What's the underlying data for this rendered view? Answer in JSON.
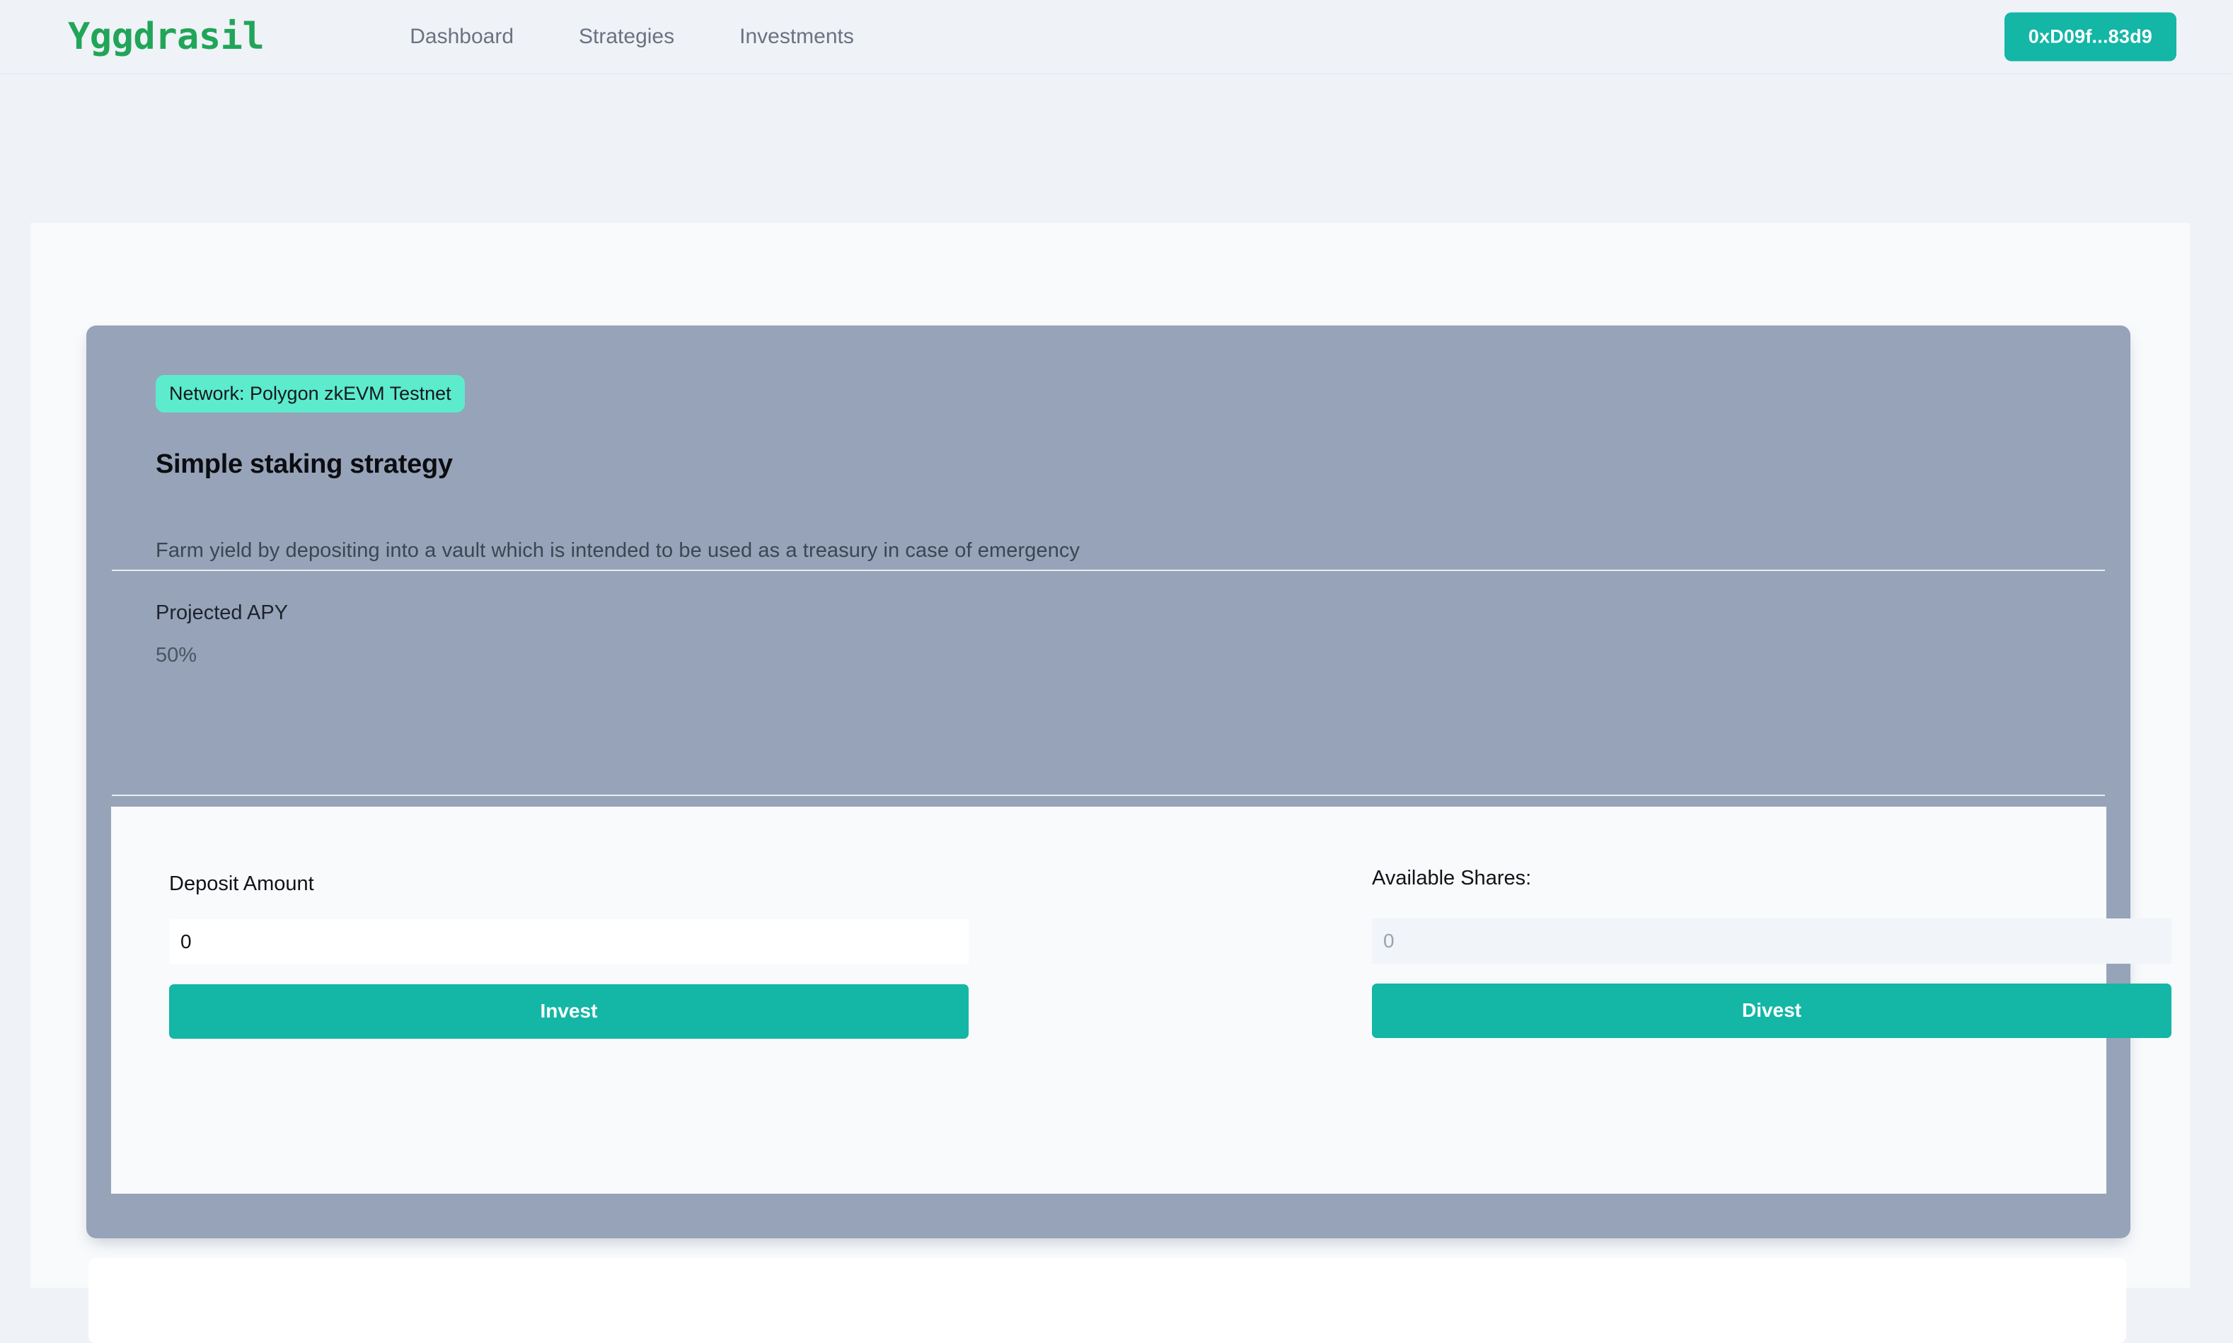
{
  "header": {
    "brand": "Yggdrasil",
    "nav": [
      {
        "label": "Dashboard"
      },
      {
        "label": "Strategies"
      },
      {
        "label": "Investments"
      }
    ],
    "wallet": {
      "address_short": "0xD09f...83d9"
    }
  },
  "strategy": {
    "network_badge": "Network: Polygon zkEVM Testnet",
    "title": "Simple staking strategy",
    "description": "Farm yield by depositing into a vault which is intended to be used as a treasury in case of emergency",
    "apy_label": "Projected APY",
    "apy_value": "50%"
  },
  "actions": {
    "deposit": {
      "label": "Deposit Amount",
      "value": "0",
      "placeholder": "0",
      "button_label": "Invest"
    },
    "shares": {
      "label": "Available Shares:",
      "value": "",
      "placeholder": "0",
      "button_label": "Divest"
    }
  },
  "colors": {
    "accent_teal": "#14b6a6",
    "brand_green": "#21a558",
    "badge_mint": "#5debcd",
    "card_slate": "#97a3b8",
    "page_bg": "#eff2f7",
    "panel_bg": "#f8fafc"
  }
}
